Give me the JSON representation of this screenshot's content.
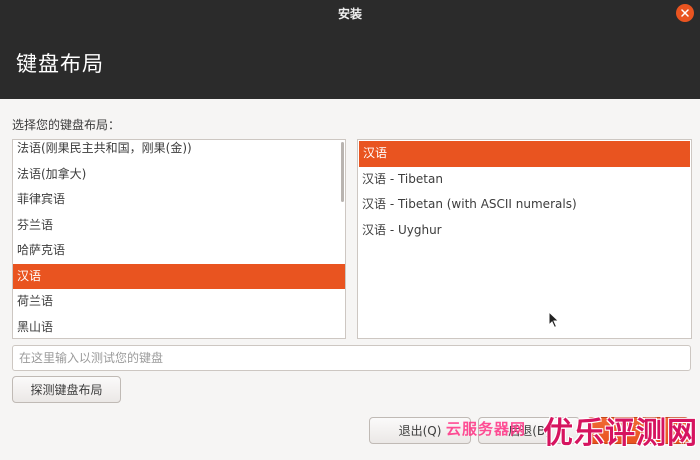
{
  "window": {
    "title": "安装",
    "close_icon": "close-icon"
  },
  "header": {
    "title": "键盘布局"
  },
  "main": {
    "prompt": "选择您的键盘布局：",
    "layouts": [
      {
        "label": "法语(刚果民主共和国，刚果(金))",
        "selected": false
      },
      {
        "label": "法语(加拿大)",
        "selected": false
      },
      {
        "label": "菲律宾语",
        "selected": false
      },
      {
        "label": "芬兰语",
        "selected": false
      },
      {
        "label": "哈萨克语",
        "selected": false
      },
      {
        "label": "汉语",
        "selected": true
      },
      {
        "label": "荷兰语",
        "selected": false
      },
      {
        "label": "黑山语",
        "selected": false
      }
    ],
    "variants": [
      {
        "label": "汉语",
        "selected": true
      },
      {
        "label": "汉语 - Tibetan",
        "selected": false
      },
      {
        "label": "汉语 - Tibetan (with ASCII numerals)",
        "selected": false
      },
      {
        "label": "汉语 - Uyghur",
        "selected": false
      }
    ],
    "test_input": {
      "value": "",
      "placeholder": "在这里输入以测试您的键盘"
    },
    "detect_button": "探测键盘布局"
  },
  "footer": {
    "quit_button": "退出(Q)",
    "back_button": "后退(B)",
    "continue_button": ""
  },
  "watermarks": {
    "left": "云服务器网",
    "right": "优乐评测网"
  },
  "colors": {
    "accent": "#e95420",
    "titlebar": "#2b2b2b",
    "background": "#f6f5f4"
  }
}
